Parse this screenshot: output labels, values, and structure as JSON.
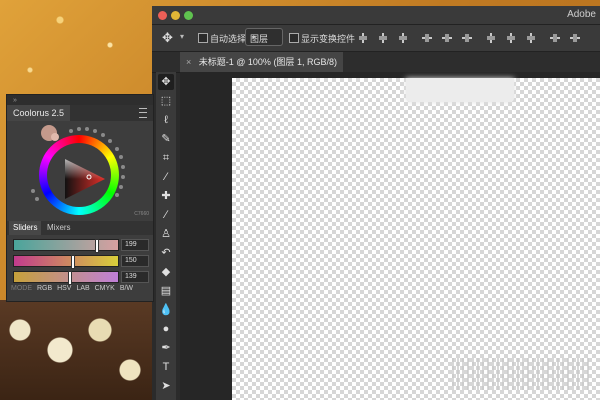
{
  "app": {
    "title": "Adobe"
  },
  "options": {
    "auto_select_label": "自动选择:",
    "layer_select_value": "图层",
    "show_transform_label": "显示变换控件"
  },
  "document": {
    "tab_title": "未标题-1 @ 100% (图层 1, RGB/8)"
  },
  "panel": {
    "title": "Coolorus 2.5",
    "tabs": [
      "Sliders",
      "Mixers"
    ],
    "sliders": [
      {
        "value": "199",
        "gradient": [
          "#4aa59b",
          "#d8a0a0"
        ],
        "position": 0.78
      },
      {
        "value": "150",
        "gradient": [
          "#c23b8d",
          "#d9cf3a"
        ],
        "position": 0.55
      },
      {
        "value": "139",
        "gradient": [
          "#c6a13a",
          "#c07fd8"
        ],
        "position": 0.52
      }
    ],
    "mode_label": "MODE",
    "modes": [
      "RGB",
      "HSV",
      "LAB",
      "CMYK",
      "B/W"
    ],
    "corner_label": "C7660"
  }
}
